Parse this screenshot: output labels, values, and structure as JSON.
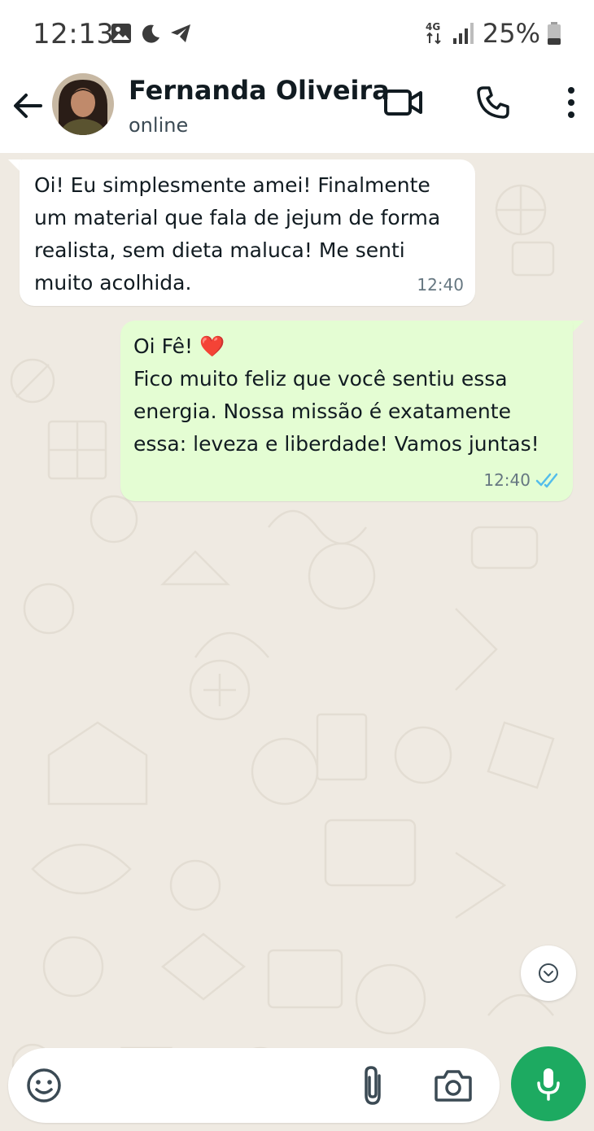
{
  "status_bar": {
    "time": "12:13",
    "network": "4G",
    "battery": "25%",
    "icons_left": [
      "gallery-icon",
      "moon-icon",
      "telegram-icon"
    ]
  },
  "header": {
    "contact_name": "Fernanda Oliveira",
    "contact_status": "online"
  },
  "messages": [
    {
      "direction": "incoming",
      "text": "Oi! Eu simplesmente amei! Finalmente\num material que fala de jejum de forma\nrealista, sem dieta maluca! Me senti\nmuito acolhida.",
      "time": "12:40"
    },
    {
      "direction": "outgoing",
      "text_greeting": "Oi Fê! ",
      "emoji": "❤️",
      "text": "Fico muito feliz que você sentiu essa\nenergia. Nossa missão é exatamente\nessa: leveza e liberdade! Vamos juntas!",
      "time": "12:40",
      "read": true
    }
  ],
  "composer": {
    "placeholder": ""
  },
  "colors": {
    "chat_background": "#efeae2",
    "outgoing_bubble": "#e4fdd3",
    "incoming_bubble": "#ffffff",
    "accent_green": "#1daa61",
    "read_ticks": "#53bdeb"
  }
}
